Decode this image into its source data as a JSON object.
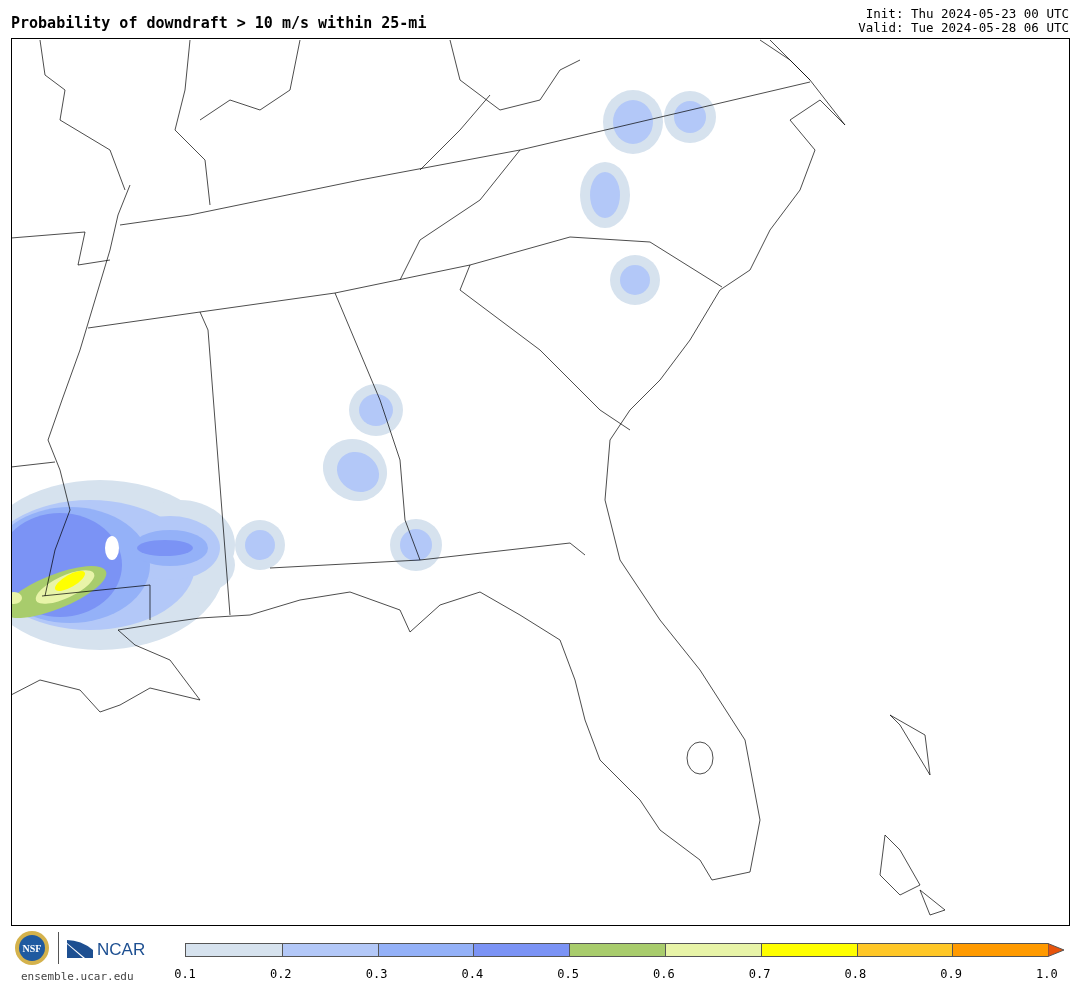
{
  "title": "Probability of downdraft > 10 m/s within 25-mi",
  "init": "Init: Thu 2024-05-23 00 UTC",
  "valid": "Valid: Tue 2024-05-28 06 UTC",
  "logos": {
    "nsf": "NSF",
    "ncar": "NCAR",
    "url": "ensemble.ucar.edu"
  },
  "colorbar": {
    "segments": [
      {
        "color": "#d6e2ee"
      },
      {
        "color": "#b3c8f8"
      },
      {
        "color": "#94b1f8"
      },
      {
        "color": "#7b93f5"
      },
      {
        "color": "#a8cc6c"
      },
      {
        "color": "#e8f4a8"
      },
      {
        "color": "#ffff00"
      },
      {
        "color": "#ffc726"
      },
      {
        "color": "#ff9a00"
      }
    ],
    "extend": {
      "color": "#e8530b"
    },
    "ticks": [
      "0.1",
      "0.2",
      "0.3",
      "0.4",
      "0.5",
      "0.6",
      "0.7",
      "0.8",
      "0.9",
      "1.0"
    ]
  }
}
